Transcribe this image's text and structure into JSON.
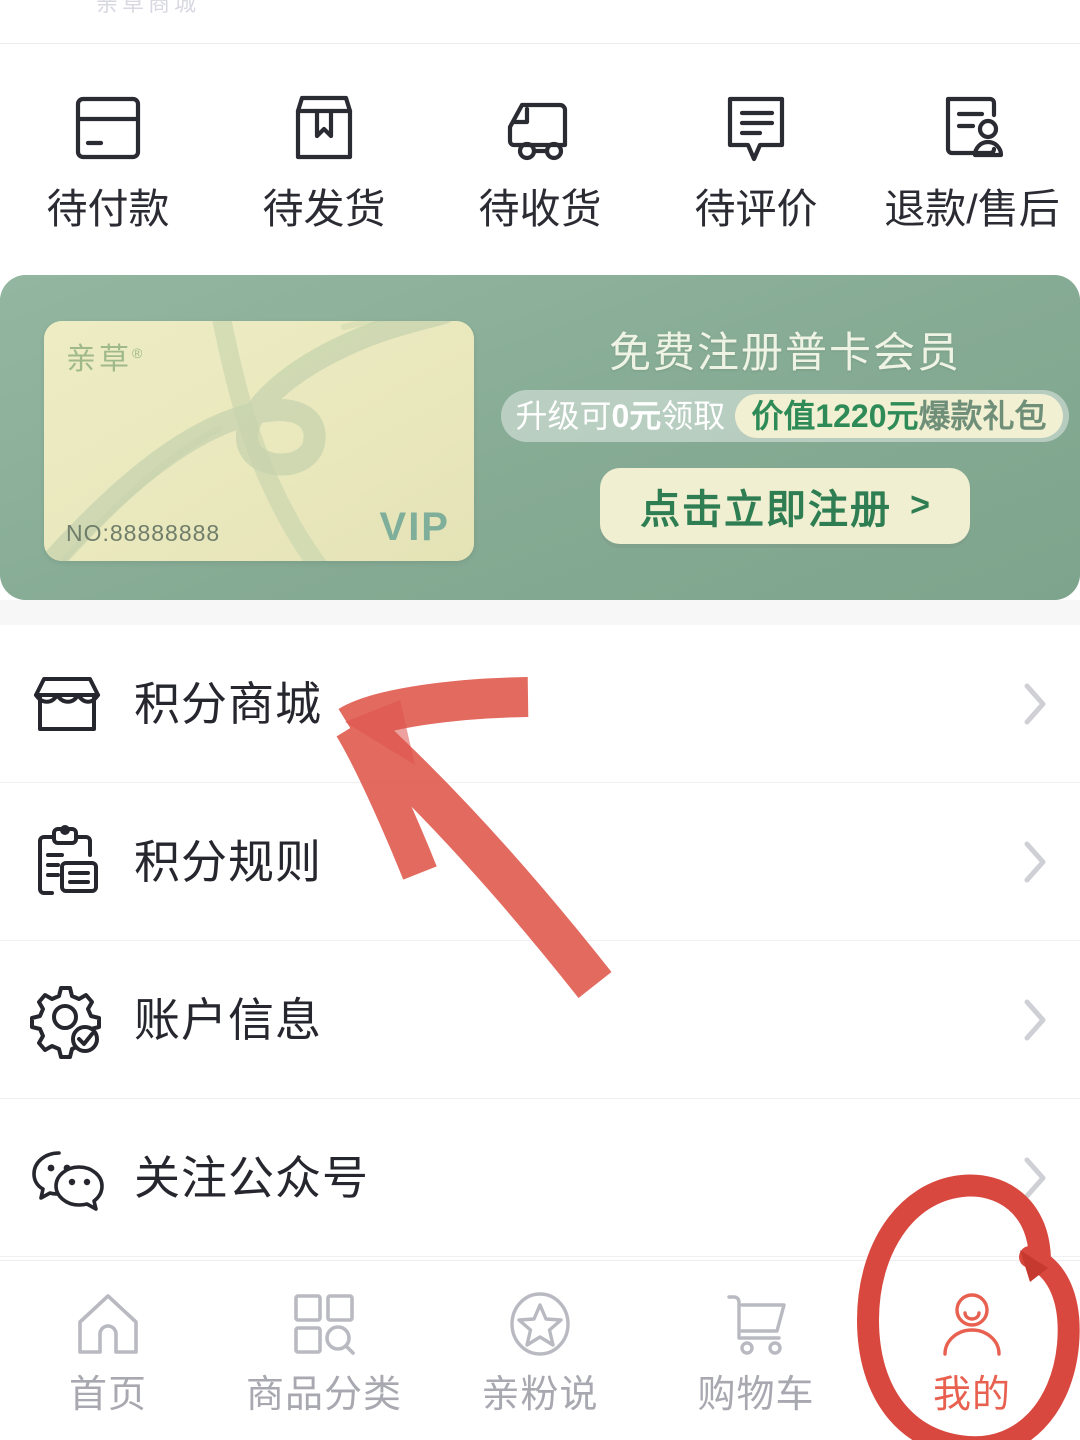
{
  "top": {
    "ghost_text": "亲草商城"
  },
  "order_status": {
    "items": [
      {
        "label": "待付款",
        "icon": "wallet-icon"
      },
      {
        "label": "待发货",
        "icon": "package-icon"
      },
      {
        "label": "待收货",
        "icon": "truck-icon"
      },
      {
        "label": "待评价",
        "icon": "comment-icon"
      },
      {
        "label": "退款/售后",
        "icon": "refund-service-icon"
      }
    ]
  },
  "vip_banner": {
    "card": {
      "brand": "亲草",
      "brand_mark": "®",
      "number": "NO:88888888",
      "tier": "VIP"
    },
    "title": "免费注册普卡会员",
    "pill_left_prefix": "升级可",
    "pill_left_amount": "0元",
    "pill_left_suffix": "领取",
    "pill_right_highlight": "价值1220元",
    "pill_right_text": "爆款礼包",
    "cta_label": "点击立即注册",
    "cta_chevron": ">",
    "colors": {
      "banner_green": "#8fb29c",
      "card_cream": "#ece9c0",
      "cta_green_text": "#2e7d53"
    }
  },
  "menu": {
    "items": [
      {
        "label": "积分商城",
        "icon": "store-icon"
      },
      {
        "label": "积分规则",
        "icon": "clipboard-icon"
      },
      {
        "label": "账户信息",
        "icon": "gear-check-icon"
      },
      {
        "label": "关注公众号",
        "icon": "wechat-icon"
      }
    ],
    "chevron": "chevron-right-icon"
  },
  "bottom_nav": {
    "items": [
      {
        "label": "首页",
        "icon": "home-icon",
        "active": false
      },
      {
        "label": "商品分类",
        "icon": "category-icon",
        "active": false
      },
      {
        "label": "亲粉说",
        "icon": "star-icon",
        "active": false
      },
      {
        "label": "购物车",
        "icon": "cart-icon",
        "active": false
      },
      {
        "label": "我的",
        "icon": "user-icon",
        "active": true
      }
    ],
    "active_color": "#e8604f",
    "inactive_color": "#a8a8b0"
  },
  "annotations": {
    "arrow": {
      "name": "red-arrow-annotation",
      "color": "#e05a4e",
      "points_to": "积分商城"
    },
    "circle": {
      "name": "red-circle-annotation",
      "color": "#d9483f",
      "encircles": "我的"
    }
  }
}
